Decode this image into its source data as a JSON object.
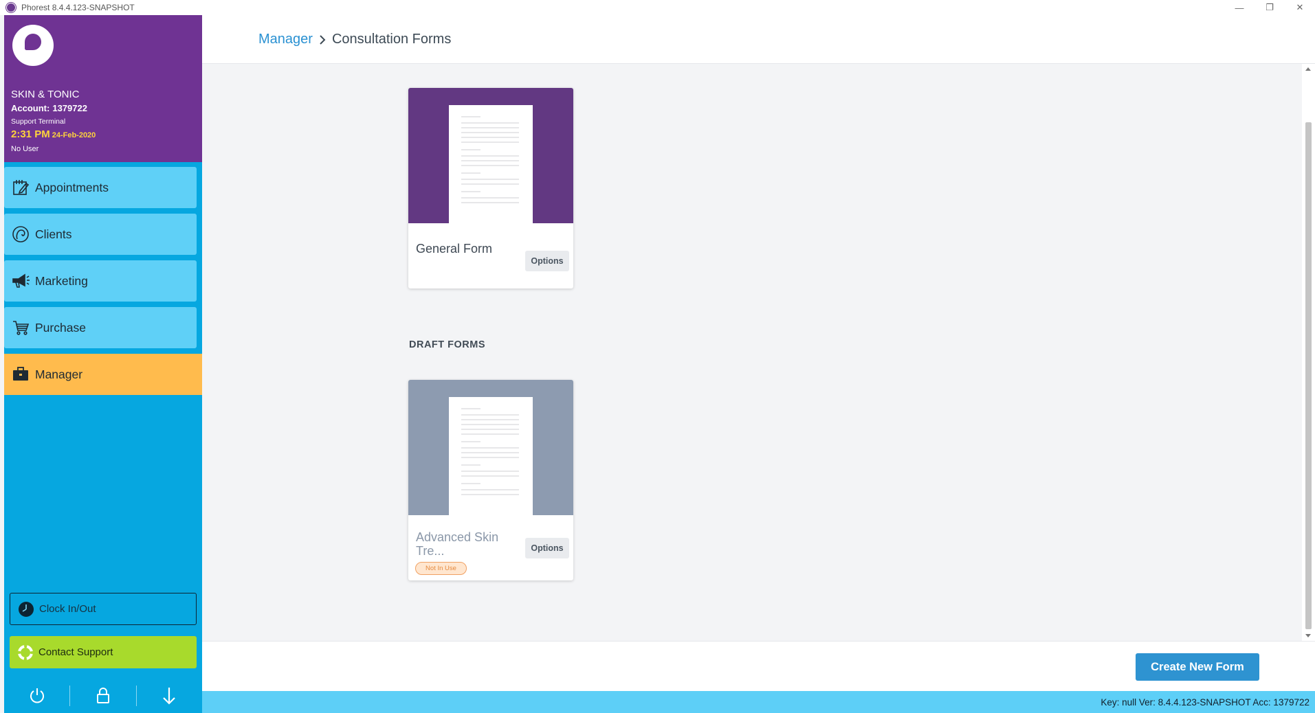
{
  "window": {
    "title": "Phorest 8.4.4.123-SNAPSHOT",
    "controls": {
      "minimize": "—",
      "restore": "❐",
      "close": "✕"
    }
  },
  "sidebar": {
    "business_name": "SKIN & TONIC",
    "account_label": "Account:",
    "account_number": "1379722",
    "terminal": "Support Terminal",
    "time": "2:31 PM",
    "date": "24-Feb-2020",
    "user": "No User",
    "items": [
      {
        "label": "Appointments",
        "icon": "calendar-edit-icon"
      },
      {
        "label": "Clients",
        "icon": "client-head-icon"
      },
      {
        "label": "Marketing",
        "icon": "megaphone-icon"
      },
      {
        "label": "Purchase",
        "icon": "cart-icon"
      },
      {
        "label": "Manager",
        "icon": "briefcase-icon",
        "active": true
      }
    ],
    "clock_label": "Clock In/Out",
    "support_label": "Contact Support",
    "bottom_icons": [
      "power-icon",
      "lock-icon",
      "arrow-down-icon"
    ]
  },
  "header": {
    "breadcrumb_root": "Manager",
    "breadcrumb_current": "Consultation Forms"
  },
  "forms": {
    "active": [
      {
        "name": "General Form",
        "options_label": "Options"
      }
    ],
    "drafts_title": "DRAFT FORMS",
    "drafts": [
      {
        "name": "Advanced Skin Tre...",
        "options_label": "Options",
        "status": "Not In Use"
      }
    ]
  },
  "footer": {
    "create_label": "Create New Form"
  },
  "statusbar": {
    "text": "Key: null Ver: 8.4.4.123-SNAPSHOT Acc: 1379722"
  },
  "colors": {
    "brand_purple": "#6f3393",
    "sidebar_blue": "#06a7e0",
    "nav_item": "#5fd0f7",
    "nav_active": "#ffbb4d",
    "support_green": "#a8da2c",
    "primary_button": "#2e93d1",
    "draft_badge": "#f0a062"
  }
}
